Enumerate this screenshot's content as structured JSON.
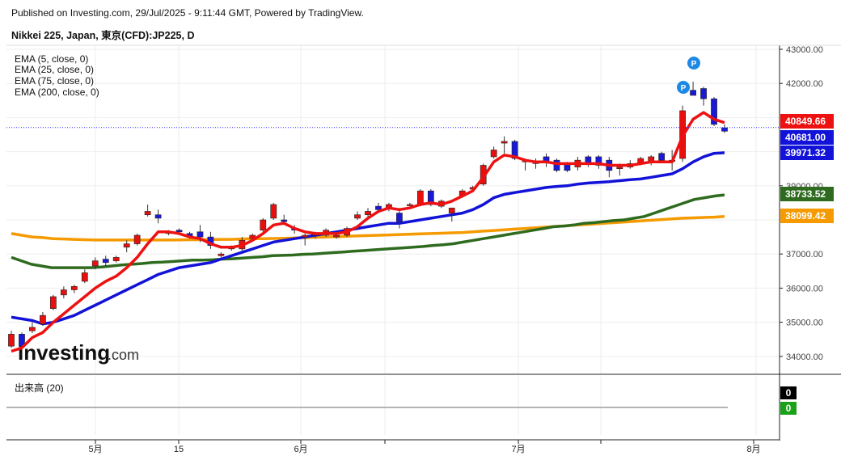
{
  "header": {
    "publish_line": "Published on Investing.com, 29/Jul/2025 - 9:11:44 GMT, Powered by TradingView.",
    "instrument_title": "Nikkei 225, Japan, 東京(CFD):JP225, D"
  },
  "legend": {
    "items": [
      "EMA (5, close, 0)",
      "EMA (25, close, 0)",
      "EMA (75, close, 0)",
      "EMA (200, close, 0)"
    ]
  },
  "volume_panel": {
    "label": "出来高 (20)",
    "values": [
      "0",
      "0"
    ],
    "value_colors": [
      "#000000",
      "#1aa11a"
    ]
  },
  "watermark": {
    "brand": "Investing",
    "suffix": ".com"
  },
  "colors": {
    "up": "#e8100e",
    "down": "#1a1ad6",
    "ema5": "#ee1111",
    "ema25": "#1212d8",
    "ema75": "#2f6b1f",
    "ema200": "#f59a00",
    "grid": "#eeeeee",
    "price_line": "#2a2aff",
    "p_marker": "#1e88e5"
  },
  "chart_data": {
    "type": "candlestick",
    "ylim": [
      33500,
      43200
    ],
    "y_ticks": [
      "43000.00",
      "42000.00",
      "39000.00",
      "37000.00",
      "36000.00",
      "35000.00",
      "34000.00"
    ],
    "x_tick_labels": [
      "5月",
      "15",
      "6月",
      "7月",
      "8月"
    ],
    "price_labels": [
      {
        "value": 40849.66,
        "text": "40849.66",
        "color": "#ee1111",
        "series": "EMA (5, close, 0)"
      },
      {
        "value": 40681.0,
        "text": "40681.00",
        "color": "#1212d8",
        "series": "close"
      },
      {
        "value": 39971.32,
        "text": "39971.32",
        "color": "#1212d8",
        "series": "EMA (25, close, 0)"
      },
      {
        "value": 38733.52,
        "text": "38733.52",
        "color": "#2f6b1f",
        "series": "EMA (75, close, 0)"
      },
      {
        "value": 38099.42,
        "text": "38099.42",
        "color": "#f59a00",
        "series": "EMA (200, close, 0)"
      }
    ],
    "candles": [
      [
        34300,
        34750,
        34250,
        34650
      ],
      [
        34650,
        34700,
        34200,
        34300
      ],
      [
        34750,
        35000,
        34680,
        34850
      ],
      [
        34950,
        35300,
        34900,
        35200
      ],
      [
        35400,
        35800,
        35350,
        35750
      ],
      [
        35800,
        36050,
        35700,
        35950
      ],
      [
        35950,
        36100,
        35850,
        36050
      ],
      [
        36200,
        36550,
        36150,
        36450
      ],
      [
        36650,
        36900,
        36550,
        36800
      ],
      [
        36850,
        36950,
        36650,
        36750
      ],
      [
        36800,
        36950,
        36750,
        36900
      ],
      [
        37200,
        37400,
        37050,
        37300
      ],
      [
        37300,
        37600,
        37250,
        37550
      ],
      [
        38150,
        38450,
        38100,
        38250
      ],
      [
        38150,
        38300,
        37900,
        38050
      ],
      [
        37600,
        37700,
        37550,
        37650
      ],
      [
        37700,
        37750,
        37600,
        37650
      ],
      [
        37600,
        37650,
        37450,
        37500
      ],
      [
        37650,
        37850,
        37350,
        37500
      ],
      [
        37500,
        37650,
        37150,
        37250
      ],
      [
        36950,
        37050,
        36900,
        37000
      ],
      [
        37150,
        37250,
        37100,
        37200
      ],
      [
        37150,
        37500,
        37100,
        37400
      ],
      [
        37450,
        37600,
        37400,
        37550
      ],
      [
        37700,
        38050,
        37650,
        38000
      ],
      [
        38050,
        38500,
        38000,
        38450
      ],
      [
        38000,
        38150,
        37850,
        37950
      ],
      [
        37750,
        37850,
        37600,
        37700
      ],
      [
        37500,
        37600,
        37250,
        37550
      ],
      [
        37550,
        37650,
        37450,
        37600
      ],
      [
        37550,
        37750,
        37500,
        37700
      ],
      [
        37500,
        37650,
        37450,
        37550
      ],
      [
        37550,
        37800,
        37500,
        37750
      ],
      [
        38050,
        38250,
        38000,
        38150
      ],
      [
        38150,
        38350,
        38050,
        38250
      ],
      [
        38400,
        38500,
        38250,
        38300
      ],
      [
        38350,
        38500,
        38250,
        38450
      ],
      [
        38200,
        38350,
        37750,
        37950
      ],
      [
        38450,
        38500,
        38400,
        38450
      ],
      [
        38450,
        38900,
        38400,
        38850
      ],
      [
        38850,
        38900,
        38400,
        38450
      ],
      [
        38400,
        38600,
        38350,
        38550
      ],
      [
        38200,
        38350,
        37950,
        38350
      ],
      [
        38700,
        38900,
        38650,
        38850
      ],
      [
        38900,
        39000,
        38850,
        38950
      ],
      [
        39050,
        39650,
        39000,
        39600
      ],
      [
        39850,
        40150,
        39800,
        40050
      ],
      [
        40250,
        40450,
        39950,
        40300
      ],
      [
        40300,
        40350,
        39750,
        39800
      ],
      [
        39700,
        39800,
        39450,
        39750
      ],
      [
        39650,
        39800,
        39500,
        39700
      ],
      [
        39850,
        39950,
        39550,
        39700
      ],
      [
        39750,
        39800,
        39400,
        39450
      ],
      [
        39650,
        39700,
        39400,
        39450
      ],
      [
        39550,
        39850,
        39450,
        39750
      ],
      [
        39850,
        39900,
        39550,
        39650
      ],
      [
        39850,
        39900,
        39500,
        39600
      ],
      [
        39750,
        39850,
        39250,
        39450
      ],
      [
        39500,
        39650,
        39300,
        39550
      ],
      [
        39550,
        39750,
        39500,
        39650
      ],
      [
        39650,
        39850,
        39600,
        39800
      ],
      [
        39700,
        39900,
        39600,
        39850
      ],
      [
        39950,
        40000,
        39700,
        39750
      ],
      [
        39750,
        40050,
        39450,
        39750
      ],
      [
        39800,
        41350,
        39700,
        41200
      ],
      [
        41800,
        42050,
        41750,
        41650
      ],
      [
        41850,
        41900,
        41350,
        41550
      ],
      [
        41550,
        41600,
        40750,
        40800
      ],
      [
        40700,
        40800,
        40550,
        40600
      ]
    ],
    "ema5": [
      34150,
      34250,
      34550,
      34700,
      35000,
      35250,
      35500,
      35750,
      36000,
      36200,
      36350,
      36600,
      36900,
      37300,
      37650,
      37650,
      37600,
      37500,
      37450,
      37300,
      37200,
      37200,
      37250,
      37400,
      37600,
      37850,
      37900,
      37750,
      37650,
      37600,
      37600,
      37600,
      37650,
      37800,
      38050,
      38250,
      38350,
      38300,
      38350,
      38450,
      38500,
      38450,
      38550,
      38700,
      38850,
      39250,
      39700,
      39900,
      39850,
      39750,
      39700,
      39700,
      39650,
      39650,
      39650,
      39650,
      39650,
      39600,
      39600,
      39600,
      39650,
      39700,
      39700,
      39700,
      40450,
      40950,
      41150,
      40950,
      40850
    ],
    "ema25": [
      35150,
      35100,
      35050,
      34950,
      35000,
      35100,
      35200,
      35350,
      35500,
      35650,
      35800,
      35950,
      36100,
      36250,
      36400,
      36500,
      36600,
      36650,
      36700,
      36750,
      36850,
      36950,
      37050,
      37150,
      37250,
      37350,
      37400,
      37450,
      37500,
      37550,
      37600,
      37650,
      37700,
      37750,
      37800,
      37850,
      37900,
      37900,
      37950,
      38000,
      38050,
      38100,
      38150,
      38200,
      38300,
      38450,
      38650,
      38750,
      38800,
      38850,
      38900,
      38950,
      38980,
      39000,
      39050,
      39080,
      39100,
      39120,
      39150,
      39180,
      39200,
      39250,
      39300,
      39350,
      39500,
      39700,
      39850,
      39950,
      39970
    ],
    "ema75": [
      36900,
      36800,
      36700,
      36650,
      36600,
      36600,
      36600,
      36600,
      36600,
      36620,
      36650,
      36680,
      36700,
      36720,
      36750,
      36760,
      36780,
      36800,
      36820,
      36820,
      36830,
      36850,
      36860,
      36880,
      36900,
      36920,
      36950,
      36960,
      36970,
      36990,
      37000,
      37020,
      37040,
      37060,
      37080,
      37100,
      37120,
      37140,
      37160,
      37180,
      37200,
      37220,
      37250,
      37270,
      37300,
      37350,
      37400,
      37450,
      37500,
      37550,
      37600,
      37650,
      37700,
      37750,
      37800,
      37820,
      37850,
      37900,
      37920,
      37950,
      37980,
      38000,
      38050,
      38100,
      38200,
      38300,
      38400,
      38500,
      38600,
      38650,
      38700,
      38733
    ],
    "ema200": [
      37600,
      37550,
      37500,
      37480,
      37450,
      37440,
      37430,
      37420,
      37410,
      37410,
      37410,
      37410,
      37410,
      37410,
      37410,
      37410,
      37415,
      37420,
      37420,
      37425,
      37430,
      37430,
      37440,
      37450,
      37450,
      37455,
      37460,
      37470,
      37480,
      37490,
      37500,
      37510,
      37520,
      37530,
      37540,
      37550,
      37560,
      37570,
      37580,
      37590,
      37600,
      37610,
      37620,
      37630,
      37650,
      37670,
      37690,
      37710,
      37730,
      37750,
      37770,
      37790,
      37810,
      37830,
      37850,
      37870,
      37890,
      37910,
      37930,
      37950,
      37970,
      37990,
      38010,
      38030,
      38050,
      38060,
      38070,
      38080,
      38099
    ]
  }
}
